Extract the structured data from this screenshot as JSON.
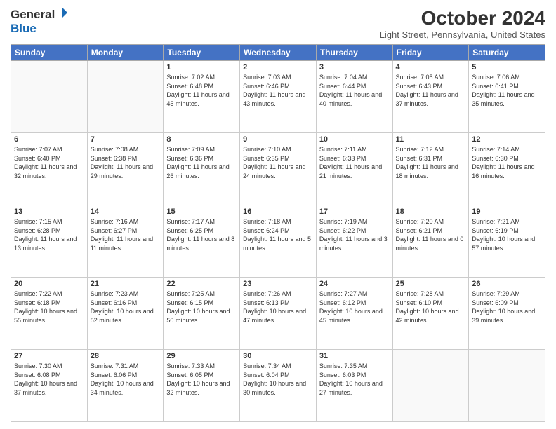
{
  "header": {
    "logo_general": "General",
    "logo_blue": "Blue",
    "month_title": "October 2024",
    "location": "Light Street, Pennsylvania, United States"
  },
  "days_of_week": [
    "Sunday",
    "Monday",
    "Tuesday",
    "Wednesday",
    "Thursday",
    "Friday",
    "Saturday"
  ],
  "weeks": [
    [
      {
        "day": "",
        "info": ""
      },
      {
        "day": "",
        "info": ""
      },
      {
        "day": "1",
        "info": "Sunrise: 7:02 AM\nSunset: 6:48 PM\nDaylight: 11 hours and 45 minutes."
      },
      {
        "day": "2",
        "info": "Sunrise: 7:03 AM\nSunset: 6:46 PM\nDaylight: 11 hours and 43 minutes."
      },
      {
        "day": "3",
        "info": "Sunrise: 7:04 AM\nSunset: 6:44 PM\nDaylight: 11 hours and 40 minutes."
      },
      {
        "day": "4",
        "info": "Sunrise: 7:05 AM\nSunset: 6:43 PM\nDaylight: 11 hours and 37 minutes."
      },
      {
        "day": "5",
        "info": "Sunrise: 7:06 AM\nSunset: 6:41 PM\nDaylight: 11 hours and 35 minutes."
      }
    ],
    [
      {
        "day": "6",
        "info": "Sunrise: 7:07 AM\nSunset: 6:40 PM\nDaylight: 11 hours and 32 minutes."
      },
      {
        "day": "7",
        "info": "Sunrise: 7:08 AM\nSunset: 6:38 PM\nDaylight: 11 hours and 29 minutes."
      },
      {
        "day": "8",
        "info": "Sunrise: 7:09 AM\nSunset: 6:36 PM\nDaylight: 11 hours and 26 minutes."
      },
      {
        "day": "9",
        "info": "Sunrise: 7:10 AM\nSunset: 6:35 PM\nDaylight: 11 hours and 24 minutes."
      },
      {
        "day": "10",
        "info": "Sunrise: 7:11 AM\nSunset: 6:33 PM\nDaylight: 11 hours and 21 minutes."
      },
      {
        "day": "11",
        "info": "Sunrise: 7:12 AM\nSunset: 6:31 PM\nDaylight: 11 hours and 18 minutes."
      },
      {
        "day": "12",
        "info": "Sunrise: 7:14 AM\nSunset: 6:30 PM\nDaylight: 11 hours and 16 minutes."
      }
    ],
    [
      {
        "day": "13",
        "info": "Sunrise: 7:15 AM\nSunset: 6:28 PM\nDaylight: 11 hours and 13 minutes."
      },
      {
        "day": "14",
        "info": "Sunrise: 7:16 AM\nSunset: 6:27 PM\nDaylight: 11 hours and 11 minutes."
      },
      {
        "day": "15",
        "info": "Sunrise: 7:17 AM\nSunset: 6:25 PM\nDaylight: 11 hours and 8 minutes."
      },
      {
        "day": "16",
        "info": "Sunrise: 7:18 AM\nSunset: 6:24 PM\nDaylight: 11 hours and 5 minutes."
      },
      {
        "day": "17",
        "info": "Sunrise: 7:19 AM\nSunset: 6:22 PM\nDaylight: 11 hours and 3 minutes."
      },
      {
        "day": "18",
        "info": "Sunrise: 7:20 AM\nSunset: 6:21 PM\nDaylight: 11 hours and 0 minutes."
      },
      {
        "day": "19",
        "info": "Sunrise: 7:21 AM\nSunset: 6:19 PM\nDaylight: 10 hours and 57 minutes."
      }
    ],
    [
      {
        "day": "20",
        "info": "Sunrise: 7:22 AM\nSunset: 6:18 PM\nDaylight: 10 hours and 55 minutes."
      },
      {
        "day": "21",
        "info": "Sunrise: 7:23 AM\nSunset: 6:16 PM\nDaylight: 10 hours and 52 minutes."
      },
      {
        "day": "22",
        "info": "Sunrise: 7:25 AM\nSunset: 6:15 PM\nDaylight: 10 hours and 50 minutes."
      },
      {
        "day": "23",
        "info": "Sunrise: 7:26 AM\nSunset: 6:13 PM\nDaylight: 10 hours and 47 minutes."
      },
      {
        "day": "24",
        "info": "Sunrise: 7:27 AM\nSunset: 6:12 PM\nDaylight: 10 hours and 45 minutes."
      },
      {
        "day": "25",
        "info": "Sunrise: 7:28 AM\nSunset: 6:10 PM\nDaylight: 10 hours and 42 minutes."
      },
      {
        "day": "26",
        "info": "Sunrise: 7:29 AM\nSunset: 6:09 PM\nDaylight: 10 hours and 39 minutes."
      }
    ],
    [
      {
        "day": "27",
        "info": "Sunrise: 7:30 AM\nSunset: 6:08 PM\nDaylight: 10 hours and 37 minutes."
      },
      {
        "day": "28",
        "info": "Sunrise: 7:31 AM\nSunset: 6:06 PM\nDaylight: 10 hours and 34 minutes."
      },
      {
        "day": "29",
        "info": "Sunrise: 7:33 AM\nSunset: 6:05 PM\nDaylight: 10 hours and 32 minutes."
      },
      {
        "day": "30",
        "info": "Sunrise: 7:34 AM\nSunset: 6:04 PM\nDaylight: 10 hours and 30 minutes."
      },
      {
        "day": "31",
        "info": "Sunrise: 7:35 AM\nSunset: 6:03 PM\nDaylight: 10 hours and 27 minutes."
      },
      {
        "day": "",
        "info": ""
      },
      {
        "day": "",
        "info": ""
      }
    ]
  ]
}
